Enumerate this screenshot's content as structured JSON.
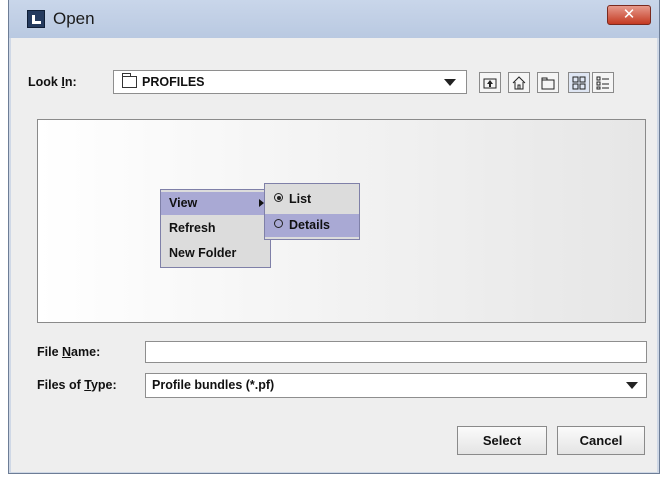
{
  "window": {
    "title": "Open",
    "close_glyph": "✕",
    "icon": "app-icon"
  },
  "look_in": {
    "label_pre": "Look ",
    "label_mnemonic": "I",
    "label_post": "n:",
    "value": "PROFILES"
  },
  "toolbar": {
    "up_icon": "up-folder-icon",
    "home_icon": "home-icon",
    "new_folder_icon": "new-folder-icon",
    "list_view_icon": "list-view-icon",
    "details_view_icon": "details-view-icon"
  },
  "context_menu": {
    "items": [
      "View",
      "Refresh",
      "New Folder"
    ],
    "submenu": [
      "List",
      "Details"
    ],
    "selected_submenu": "List",
    "highlighted": [
      "View",
      "Details"
    ]
  },
  "file_name": {
    "label_pre": "File ",
    "label_mnemonic": "N",
    "label_post": "ame:",
    "value": ""
  },
  "file_type": {
    "label_pre": "Files of ",
    "label_mnemonic": "T",
    "label_post": "ype:",
    "value": "Profile bundles (*.pf)"
  },
  "buttons": {
    "select": "Select",
    "cancel": "Cancel"
  },
  "colors": {
    "menu_highlight": "#a9a9d4",
    "close_button": "#c43a22"
  }
}
